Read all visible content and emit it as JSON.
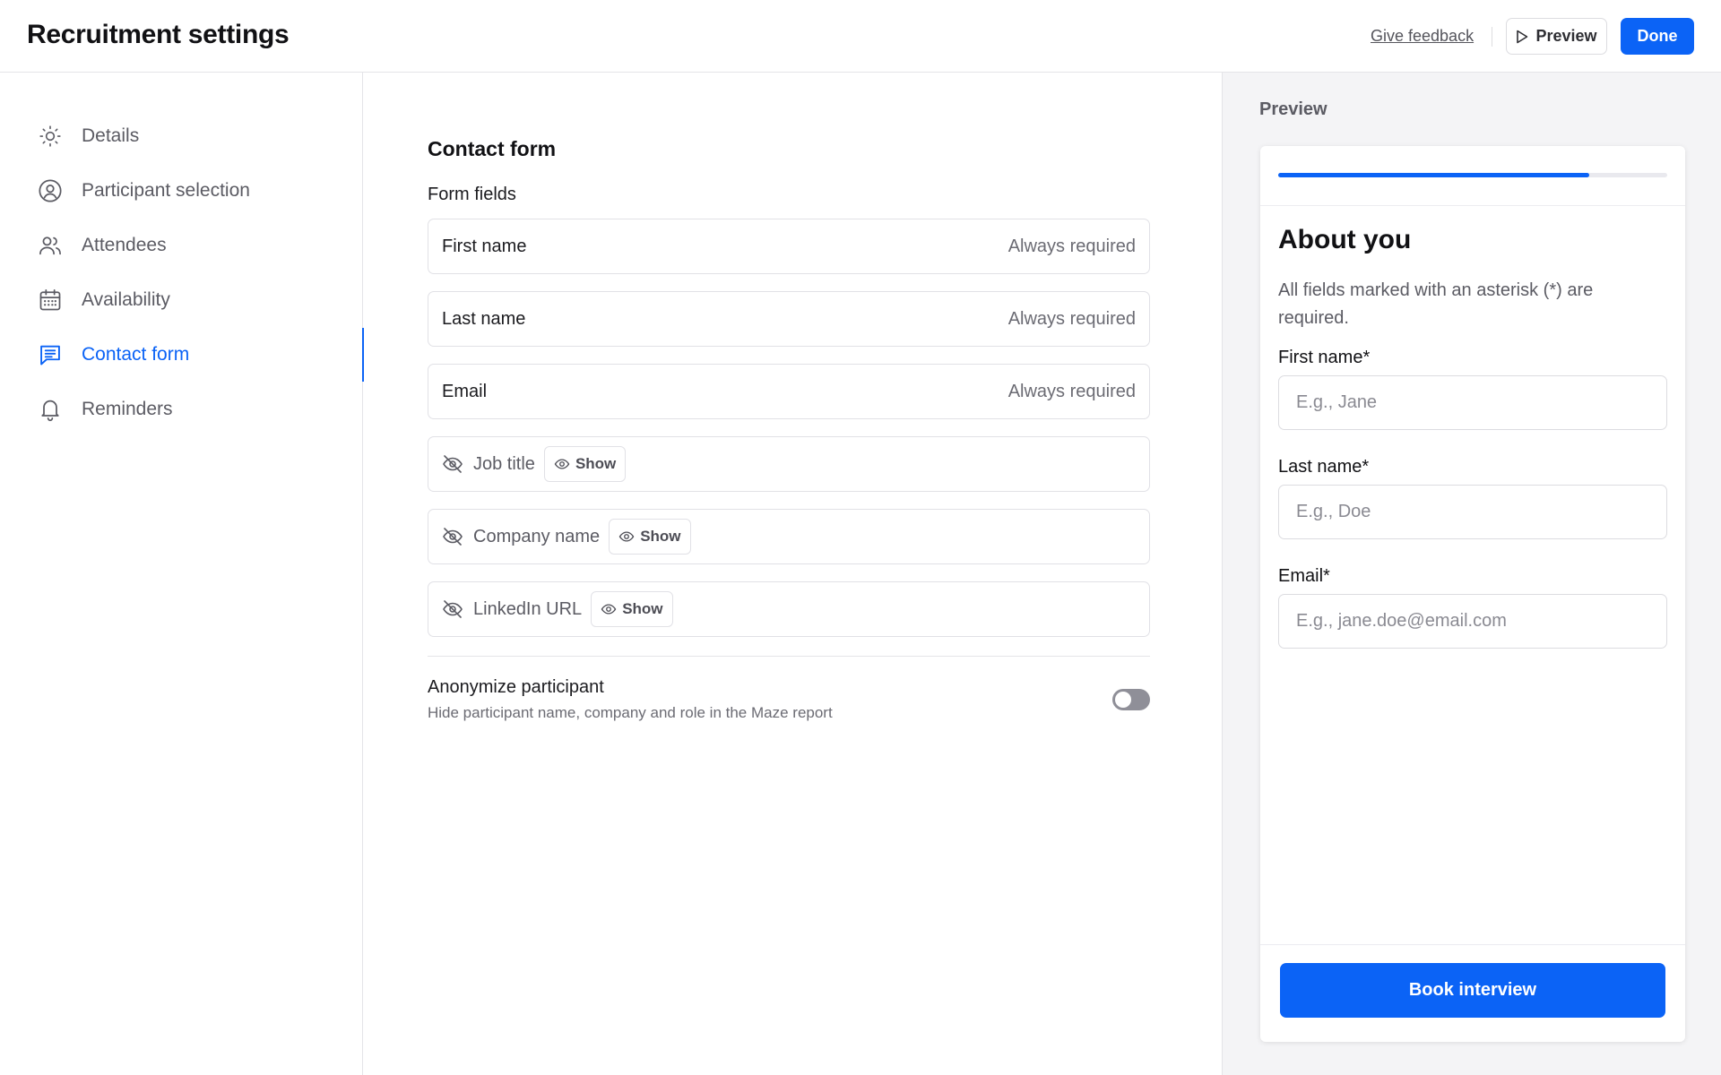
{
  "header": {
    "title": "Recruitment settings",
    "feedback_label": "Give feedback",
    "preview_label": "Preview",
    "done_label": "Done"
  },
  "sidebar": {
    "items": [
      {
        "label": "Details",
        "icon": "sun-icon"
      },
      {
        "label": "Participant selection",
        "icon": "user-circle-icon"
      },
      {
        "label": "Attendees",
        "icon": "users-icon"
      },
      {
        "label": "Availability",
        "icon": "calendar-icon"
      },
      {
        "label": "Contact form",
        "icon": "message-square-icon",
        "active": true
      },
      {
        "label": "Reminders",
        "icon": "bell-icon"
      }
    ]
  },
  "main": {
    "section_title": "Contact form",
    "fields_label": "Form fields",
    "fields": [
      {
        "name": "First name",
        "status": "Always required"
      },
      {
        "name": "Last name",
        "status": "Always required"
      },
      {
        "name": "Email",
        "status": "Always required"
      },
      {
        "name": "Job title",
        "action": "Show"
      },
      {
        "name": "Company name",
        "action": "Show"
      },
      {
        "name": "LinkedIn URL",
        "action": "Show"
      }
    ],
    "anonymize": {
      "title": "Anonymize participant",
      "description": "Hide participant name, company and role in the Maze report",
      "enabled": false
    }
  },
  "preview": {
    "heading": "Preview",
    "progress": 0.8,
    "title": "About you",
    "note": "All fields marked with an asterisk (*) are required.",
    "fields": [
      {
        "label": "First name*",
        "placeholder": "E.g., Jane"
      },
      {
        "label": "Last name*",
        "placeholder": "E.g., Doe"
      },
      {
        "label": "Email*",
        "placeholder": "E.g., jane.doe@email.com"
      }
    ],
    "submit_label": "Book interview"
  },
  "colors": {
    "accent": "#0b63f6",
    "text": "#1b1b1f",
    "muted": "#6b6b73",
    "border": "#e1e1e6",
    "preview_bg": "#f4f4f6"
  }
}
